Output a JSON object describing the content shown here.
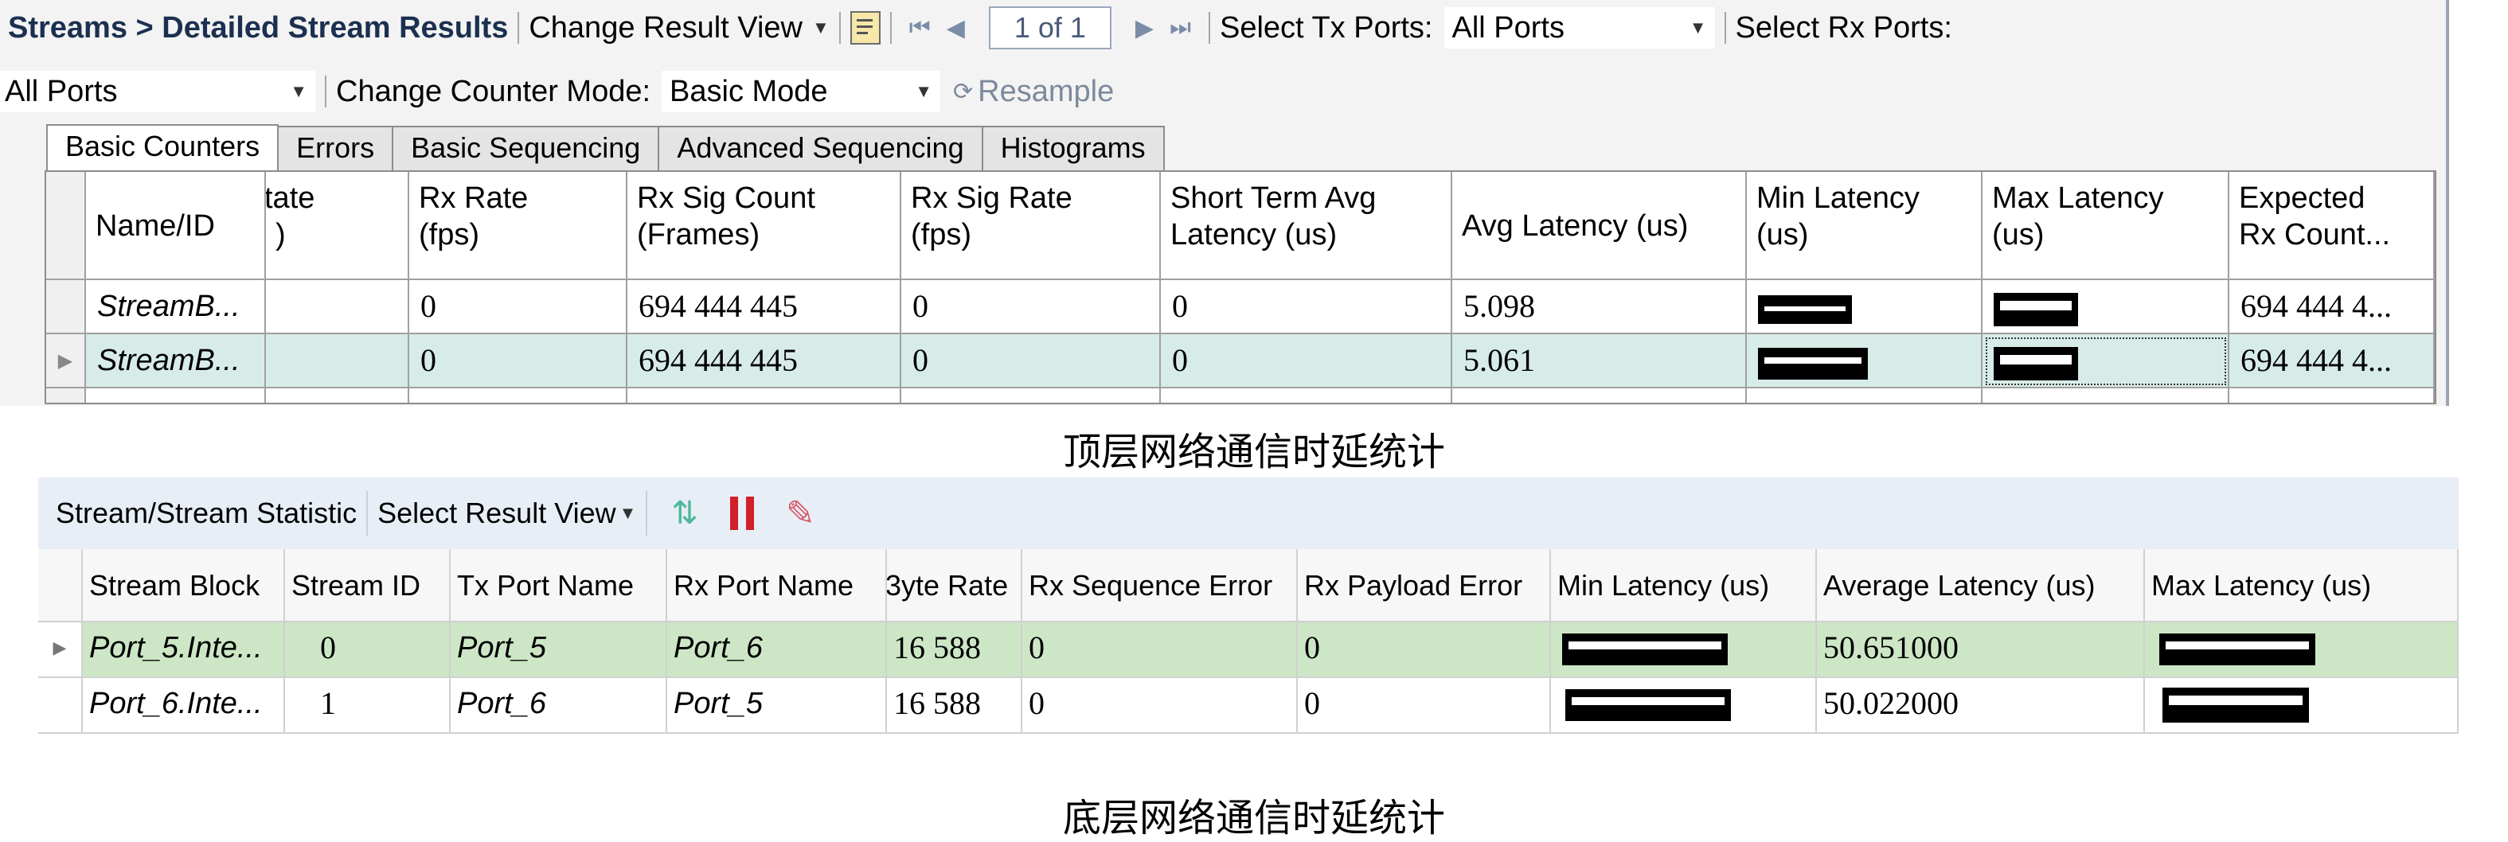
{
  "top_panel": {
    "toolbar": {
      "breadcrumb": "Streams > Detailed Stream Results",
      "change_result_view": "Change Result View",
      "page_indicator": "1 of 1",
      "select_tx_ports_label": "Select Tx Ports:",
      "select_tx_ports_value": "All Ports",
      "select_rx_ports_label": "Select Rx Ports:",
      "select_rx_ports_value": "All Ports",
      "change_counter_mode_label": "Change Counter Mode:",
      "counter_mode_value": "Basic Mode",
      "resample": "Resample"
    },
    "tabs": [
      "Basic Counters",
      "Errors",
      "Basic Sequencing",
      "Advanced Sequencing",
      "Histograms"
    ],
    "columns": [
      "Name/ID",
      "tate\n)",
      "Rx Rate\n(fps)",
      "Rx Sig Count\n(Frames)",
      "Rx Sig Rate\n(fps)",
      "Short Term Avg\nLatency (us)",
      "Avg Latency (us)",
      "Min Latency\n(us)",
      "Max Latency\n(us)",
      "Expected\nRx Count..."
    ],
    "rows": [
      {
        "name": "StreamB...",
        "rate": "",
        "rx_rate": "0",
        "rx_sig_count": "694 444 445",
        "rx_sig_rate": "0",
        "short_term_avg_latency": "0",
        "avg_latency": "5.098",
        "expected_rx_count": "694 444 4..."
      },
      {
        "name": "StreamB...",
        "rate": "",
        "rx_rate": "0",
        "rx_sig_count": "694 444 445",
        "rx_sig_rate": "0",
        "short_term_avg_latency": "0",
        "avg_latency": "5.061",
        "expected_rx_count": "694 444 4..."
      }
    ],
    "caption": "顶层网络通信时延统计"
  },
  "bottom_panel": {
    "toolbar": {
      "title": "Stream/Stream Statistic",
      "select_result_view": "Select Result View"
    },
    "columns": [
      "Stream Block",
      "Stream ID",
      "Tx Port Name",
      "Rx Port Name",
      "3yte Rate",
      "Rx Sequence Error",
      "Rx Payload Error",
      "Min Latency (us)",
      "Average Latency (us)",
      "Max Latency (us)"
    ],
    "rows": [
      {
        "stream_block": "Port_5.Inte...",
        "stream_id": "0",
        "tx_port": "Port_5",
        "rx_port": "Port_6",
        "byte_rate": "16 588",
        "rx_seq_error": "0",
        "rx_payload_error": "0",
        "avg_latency": "50.651000"
      },
      {
        "stream_block": "Port_6.Inte...",
        "stream_id": "1",
        "tx_port": "Port_6",
        "rx_port": "Port_5",
        "byte_rate": "16 588",
        "rx_seq_error": "0",
        "rx_payload_error": "0",
        "avg_latency": "50.022000"
      }
    ],
    "caption": "底层网络通信时延统计"
  },
  "colors": {
    "selected_row_top": "#d7ece9",
    "selected_row_bottom": "#cde7c6",
    "redaction": "#000000",
    "pause_icon": "#d0202a",
    "refresh_icon": "#4fb89a"
  },
  "icons": [
    "dropdown-arrow-icon",
    "export-icon",
    "first-page-icon",
    "prev-page-icon",
    "next-page-icon",
    "last-page-icon",
    "resample-icon",
    "refresh-icon",
    "pause-icon",
    "clear-icon",
    "row-indicator-icon"
  ]
}
